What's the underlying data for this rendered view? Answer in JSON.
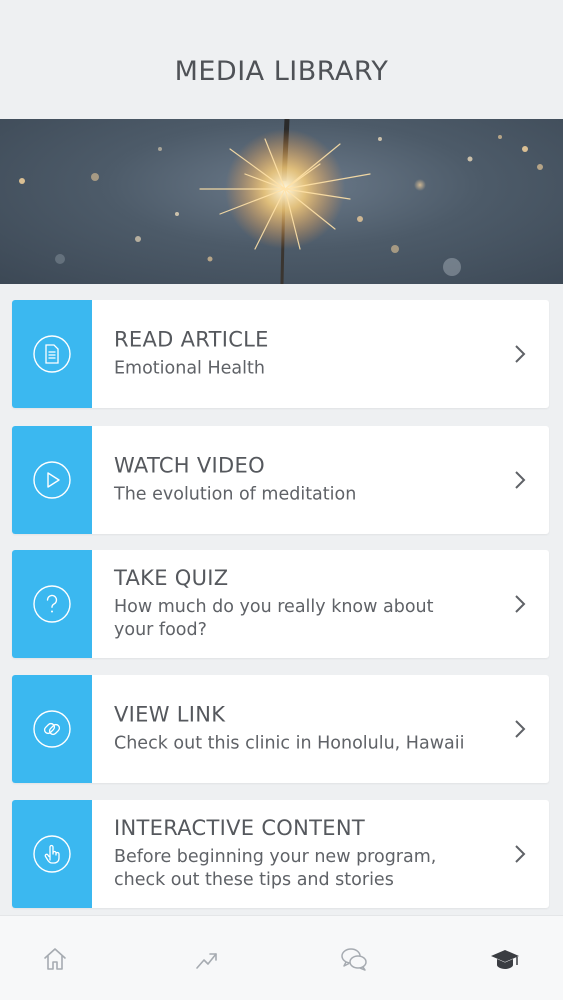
{
  "header": {
    "title": "MEDIA LIBRARY"
  },
  "hero": {
    "image": "sparkler-photo"
  },
  "items": [
    {
      "title": "READ ARTICLE",
      "subtitle": "Emotional Health",
      "icon": "document-icon"
    },
    {
      "title": "WATCH VIDEO",
      "subtitle": "The evolution of meditation",
      "icon": "play-icon"
    },
    {
      "title": "TAKE QUIZ",
      "subtitle": "How much do you really know about your food?",
      "icon": "question-icon"
    },
    {
      "title": "VIEW LINK",
      "subtitle": "Check out this clinic in Honolulu, Hawaii",
      "icon": "link-icon"
    },
    {
      "title": "INTERACTIVE CONTENT",
      "subtitle": "Before beginning your new program, check out these tips and stories",
      "icon": "hand-pointer-icon"
    }
  ],
  "tabbar": {
    "tabs": [
      {
        "icon": "home-icon",
        "active": false
      },
      {
        "icon": "trend-icon",
        "active": false
      },
      {
        "icon": "chat-icon",
        "active": false
      },
      {
        "icon": "graduation-cap-icon",
        "active": true
      }
    ]
  },
  "colors": {
    "accent": "#3bb8f0",
    "background": "#eef0f2",
    "text": "#55585d"
  }
}
